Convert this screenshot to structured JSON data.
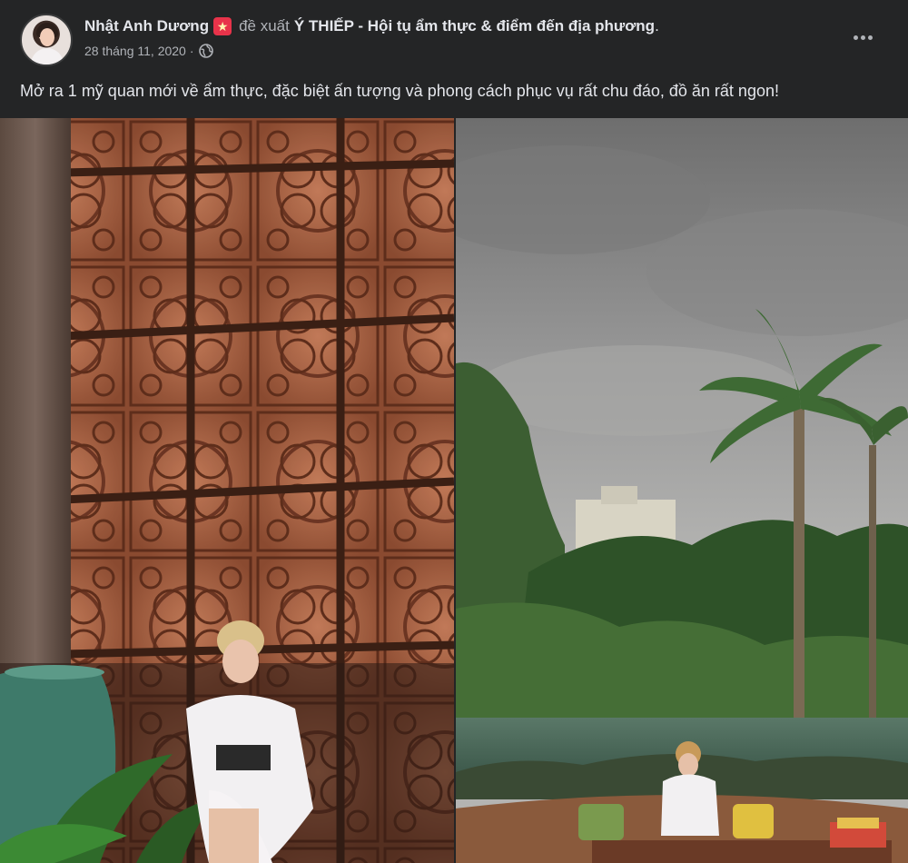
{
  "post": {
    "author": "Nhật Anh Dương",
    "author_badge": "★",
    "verb": "đề xuất",
    "page_name": "Ý THIẾP - Hội tụ ẩm thực & điểm đến địa phương",
    "page_suffix": ".",
    "date": "28 tháng 11, 2020",
    "separator": "·",
    "privacy_icon": "globe-icon",
    "more_icon": "more-options-icon",
    "text": "Mở ra 1 mỹ quan mới về ẩm thực, đặc biệt ấn tượng và phong cách phục vụ rất chu đáo, đồ ăn rất ngon!",
    "photos": [
      "photo-woman-in-front-of-carved-wall",
      "photo-terrace-with-palm-trees"
    ]
  },
  "colors": {
    "background": "#242526",
    "primary_text": "#e4e6eb",
    "secondary_text": "#b0b3b8",
    "badge": "#e8334a"
  }
}
